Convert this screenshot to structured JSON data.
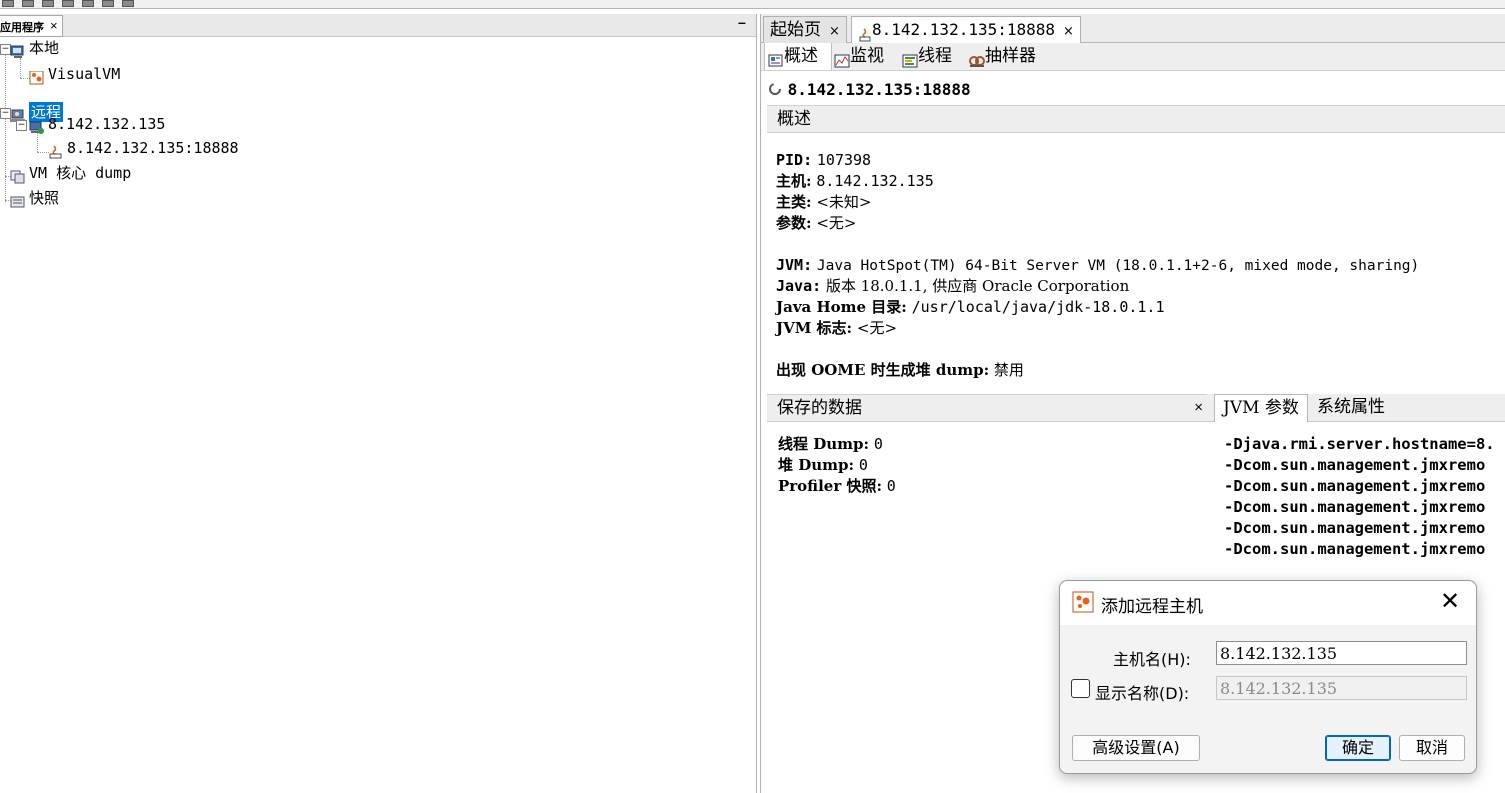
{
  "left_panel": {
    "tab_label": "应用程序",
    "minimize_symbol": "–",
    "tree": {
      "local": "本地",
      "visualvm": "VisualVM",
      "remote": "远程",
      "host": "8.142.132.135",
      "jmx": "8.142.132.135:18888",
      "vm_coredump": "VM 核心 dump",
      "snapshots": "快照"
    }
  },
  "right_panel": {
    "doc_tabs": [
      {
        "label": "起始页"
      },
      {
        "label": "8.142.132.135:18888"
      }
    ],
    "sub_tabs": [
      {
        "label": "概述",
        "icon": "overview-icon"
      },
      {
        "label": "监视",
        "icon": "monitor-icon"
      },
      {
        "label": "线程",
        "icon": "threads-icon"
      },
      {
        "label": "抽样器",
        "icon": "sampler-icon"
      }
    ],
    "app_title": "8.142.132.135:18888",
    "section_overview": "概述",
    "info": {
      "pid_label": "PID:",
      "pid_value": "107398",
      "host_label": "主机:",
      "host_value": "8.142.132.135",
      "mainclass_label": "主类:",
      "mainclass_value": "<未知>",
      "args_label": "参数:",
      "args_value": "<无>",
      "jvm_label": "JVM:",
      "jvm_value": "Java HotSpot(TM) 64-Bit Server VM (18.0.1.1+2-6, mixed mode, sharing)",
      "java_label": "Java:",
      "java_value": "版本 18.0.1.1, 供应商 Oracle Corporation",
      "javahome_label": "Java Home 目录:",
      "javahome_value": "/usr/local/java/jdk-18.0.1.1",
      "jvmflags_label": "JVM 标志:",
      "jvmflags_value": "<无>",
      "oome_label": "出现 OOME 时生成堆 dump:",
      "oome_value": "禁用"
    },
    "saved_data": {
      "header": "保存的数据",
      "thread_dump_label": "线程 Dump:",
      "thread_dump_value": "0",
      "heap_dump_label": "堆 Dump:",
      "heap_dump_value": "0",
      "profiler_label": "Profiler 快照:",
      "profiler_value": "0"
    },
    "jvm_args_tabs": [
      {
        "label": "JVM 参数"
      },
      {
        "label": "系统属性"
      }
    ],
    "jvm_args": [
      "-Djava.rmi.server.hostname=8.",
      "-Dcom.sun.management.jmxremo",
      "-Dcom.sun.management.jmxremo",
      "-Dcom.sun.management.jmxremo",
      "-Dcom.sun.management.jmxremo",
      "-Dcom.sun.management.jmxremo"
    ]
  },
  "dialog": {
    "title": "添加远程主机",
    "hostname_label": "主机名(H):",
    "hostname_value": "8.142.132.135",
    "display_name_label": "显示名称(D):",
    "display_name_value": "8.142.132.135",
    "display_name_checked": false,
    "advanced_button": "高级设置(A)",
    "ok_button": "确定",
    "cancel_button": "取消"
  },
  "colors": {
    "selection": "#0078d7",
    "visualvm_orange": "#e8601c",
    "dialog_default_border": "#0067c0"
  }
}
